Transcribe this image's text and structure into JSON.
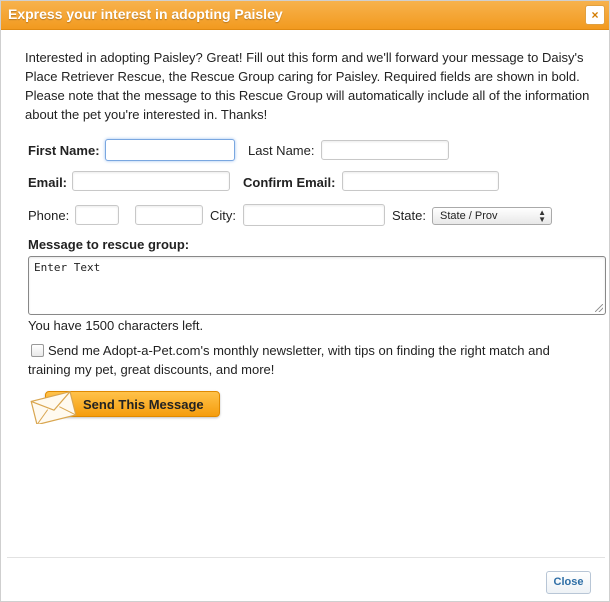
{
  "dialog": {
    "title": "Express your interest in adopting Paisley",
    "close_symbol": "×"
  },
  "intro_text": "Interested in adopting Paisley? Great! Fill out this form and we'll forward your message to Daisy's Place Retriever Rescue, the Rescue Group caring for Paisley. Required fields are shown in bold. Please note that the message to this Rescue Group will automatically include all of the information about the pet you're interested in. Thanks!",
  "form": {
    "first_name_label": "First Name:",
    "last_name_label": "Last Name:",
    "email_label": "Email:",
    "confirm_email_label": "Confirm Email:",
    "phone_label": "Phone:",
    "city_label": "City:",
    "state_label": "State:",
    "state_selected": "State / Prov",
    "message_label": "Message to rescue group:",
    "message_placeholder": "Enter Text",
    "chars_left": "You have 1500 characters left.",
    "newsletter_text": "Send me Adopt-a-Pet.com's monthly newsletter, with tips on finding the right match and training my pet, great discounts, and more!",
    "newsletter_checked": false,
    "send_label": "Send This Message"
  },
  "footer": {
    "close_label": "Close"
  },
  "colors": {
    "titlebar": "#f29a1f",
    "send_button": "#f59d0d",
    "close_link": "#2e6ea6"
  }
}
